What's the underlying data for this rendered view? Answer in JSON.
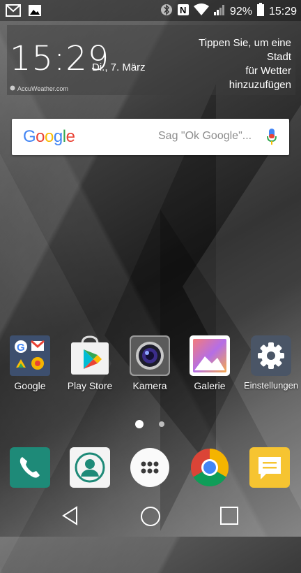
{
  "status_bar": {
    "battery": "92%",
    "time": "15:29",
    "left_icons": [
      "gmail-icon",
      "gallery-notification-icon"
    ],
    "right_icons": [
      "bluetooth-icon",
      "nfc-icon",
      "wifi-icon",
      "signal-icon",
      "battery-icon"
    ]
  },
  "weather_widget": {
    "time": "15:29",
    "date": "Di., 7. März",
    "prompt_lines": [
      "Tippen Sie, um eine",
      "Stadt",
      "für Wetter",
      "hinzuzufügen"
    ],
    "brand": "AccuWeather.com"
  },
  "search": {
    "logo": "Google",
    "placeholder": "Sag \"Ok Google\"..."
  },
  "apps": [
    {
      "label": "Google",
      "icon": "google-folder-icon"
    },
    {
      "label": "Play Store",
      "icon": "play-store-icon"
    },
    {
      "label": "Kamera",
      "icon": "camera-icon"
    },
    {
      "label": "Galerie",
      "icon": "gallery-icon"
    },
    {
      "label": "Einstellungen",
      "icon": "settings-icon"
    }
  ],
  "page_indicator": {
    "pages": 2,
    "current": 1
  },
  "dock": [
    "phone-icon",
    "contacts-icon",
    "app-drawer-icon",
    "chrome-icon",
    "messages-icon"
  ],
  "navigation": [
    "back-icon",
    "home-icon",
    "recents-icon"
  ],
  "colors": {
    "google_blue": "#4285F4",
    "google_red": "#EA4335",
    "google_yellow": "#FBBC05",
    "google_green": "#34A853",
    "phone_green": "#1e8a78",
    "messages_yellow": "#f6c431"
  }
}
